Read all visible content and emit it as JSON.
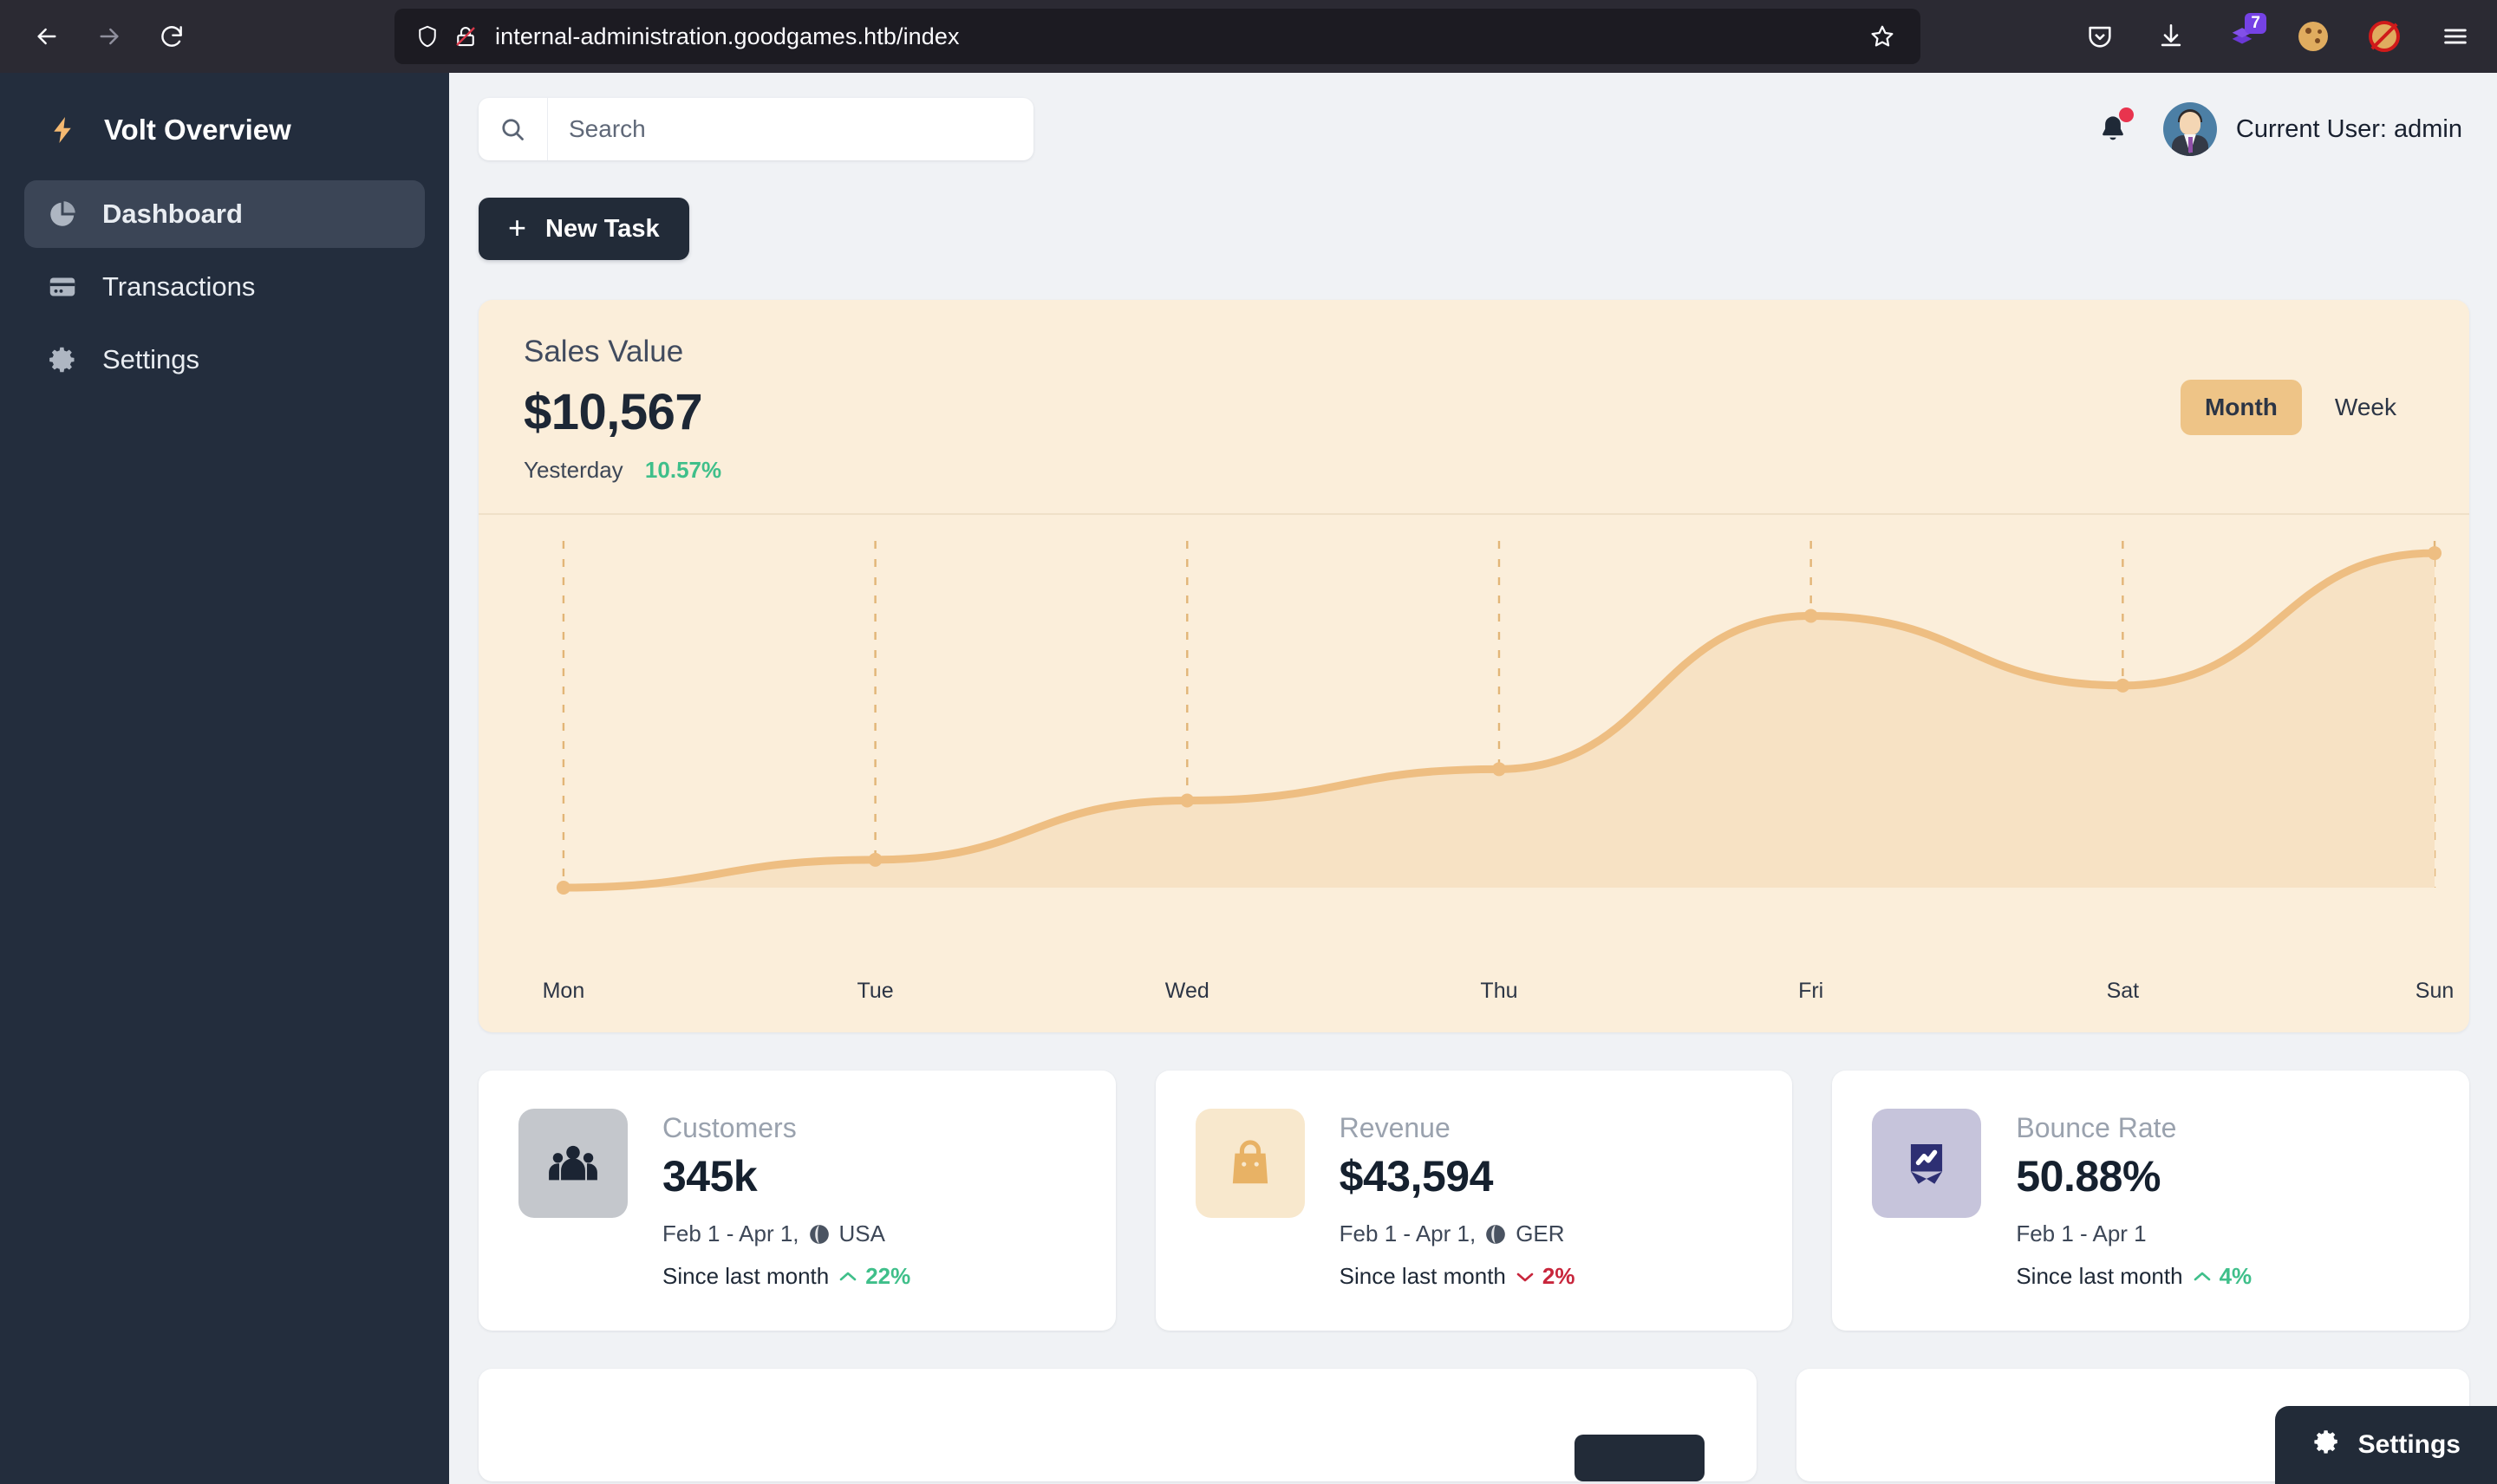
{
  "browser": {
    "url": "internal-administration.goodgames.htb/index",
    "back_icon": "back-arrow-icon",
    "forward_icon": "forward-arrow-icon",
    "reload_icon": "reload-icon",
    "shield_icon": "shield-icon",
    "insecure_icon": "broken-padlock-icon",
    "bookmark_icon": "star-icon",
    "pocket_icon": "pocket-icon",
    "downloads_icon": "download-icon",
    "layers_badge": "7",
    "cookie_icon": "cookie-icon",
    "nofox_icon": "no-fox-icon",
    "menu_icon": "hamburger-menu-icon"
  },
  "sidebar": {
    "brand": "Volt Overview",
    "brand_icon": "lightning-bolt-icon",
    "items": [
      {
        "label": "Dashboard",
        "icon": "pie-chart-icon",
        "active": true
      },
      {
        "label": "Transactions",
        "icon": "credit-card-icon",
        "active": false
      },
      {
        "label": "Settings",
        "icon": "gear-icon",
        "active": false
      }
    ]
  },
  "topbar": {
    "search_placeholder": "Search",
    "search_value": "",
    "search_icon": "search-icon",
    "bell_icon": "bell-icon",
    "has_notification": true,
    "avatar": "user-avatar",
    "user_label": "Current User: admin"
  },
  "toolbar": {
    "new_task_label": "New Task",
    "new_task_icon": "plus-icon"
  },
  "sales": {
    "title": "Sales Value",
    "value": "$10,567",
    "compare_label": "Yesterday",
    "compare_pct": "10.57%",
    "range_options": [
      "Month",
      "Week"
    ],
    "range_selected": "Month"
  },
  "chart_data": {
    "type": "area",
    "title": "Sales Value",
    "categories": [
      "Mon",
      "Tue",
      "Wed",
      "Thu",
      "Fri",
      "Sat",
      "Sun"
    ],
    "values": [
      0,
      8,
      25,
      34,
      78,
      58,
      96
    ],
    "series": [
      {
        "name": "Sales Value",
        "values": [
          0,
          8,
          25,
          34,
          78,
          58,
          96
        ]
      }
    ],
    "xlabel": "",
    "ylabel": "",
    "ylim": [
      0,
      100
    ],
    "grid": "vertical-dashed",
    "legend": "none",
    "line_color": "#eebe82",
    "fill_color": "#f7e2c4",
    "marker_color": "#eebe82"
  },
  "stats": [
    {
      "label": "Customers",
      "value": "345k",
      "range": "Feb 1 - Apr 1,",
      "region": "USA",
      "since_label": "Since last month",
      "change": "22%",
      "direction": "up",
      "icon": "people-group-icon",
      "icon_bg": "#c4c7cc",
      "icon_fg": "#1b2433"
    },
    {
      "label": "Revenue",
      "value": "$43,594",
      "range": "Feb 1 - Apr 1,",
      "region": "GER",
      "since_label": "Since last month",
      "change": "2%",
      "direction": "down",
      "icon": "shopping-bag-icon",
      "icon_bg": "#f8e8cd",
      "icon_fg": "#e8b265"
    },
    {
      "label": "Bounce Rate",
      "value": "50.88%",
      "range": "Feb 1 - Apr 1",
      "region": "",
      "since_label": "Since last month",
      "change": "4%",
      "direction": "up",
      "icon": "chart-banner-icon",
      "icon_bg": "#c6c4db",
      "icon_fg": "#2d2f73"
    }
  ],
  "fab": {
    "label": "Settings",
    "icon": "gear-icon"
  }
}
